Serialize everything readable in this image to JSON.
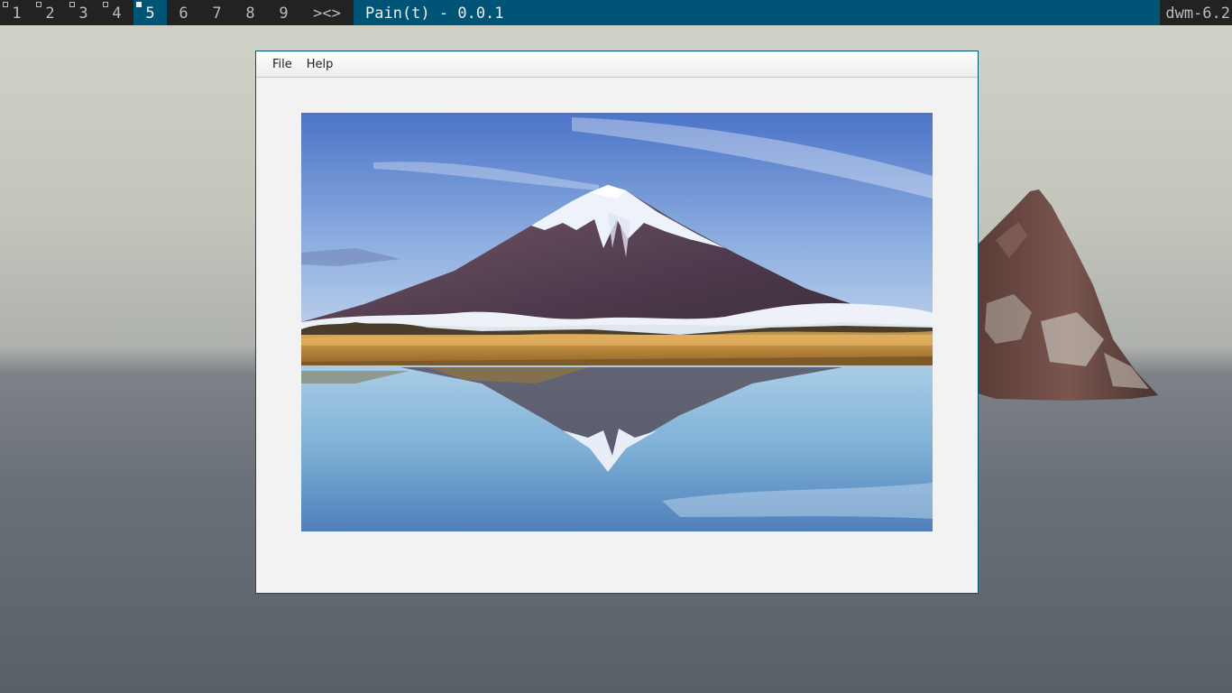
{
  "bar": {
    "tags": [
      {
        "label": "1",
        "occupied": true,
        "selected": false
      },
      {
        "label": "2",
        "occupied": true,
        "selected": false
      },
      {
        "label": "3",
        "occupied": true,
        "selected": false
      },
      {
        "label": "4",
        "occupied": true,
        "selected": false
      },
      {
        "label": "5",
        "occupied": true,
        "selected": true
      },
      {
        "label": "6",
        "occupied": false,
        "selected": false
      },
      {
        "label": "7",
        "occupied": false,
        "selected": false
      },
      {
        "label": "8",
        "occupied": false,
        "selected": false
      },
      {
        "label": "9",
        "occupied": false,
        "selected": false
      }
    ],
    "layout_symbol": "><>",
    "window_title": "Pain(t) - 0.0.1",
    "status": "dwm-6.2",
    "colors": {
      "bar_bg": "#222222",
      "accent": "#005577",
      "fg": "#bbbbbb",
      "fg_selected": "#eeeeee"
    }
  },
  "window": {
    "menu": {
      "file_label": "File",
      "help_label": "Help"
    },
    "canvas_image": "mountain-lake-reflection-photo"
  }
}
